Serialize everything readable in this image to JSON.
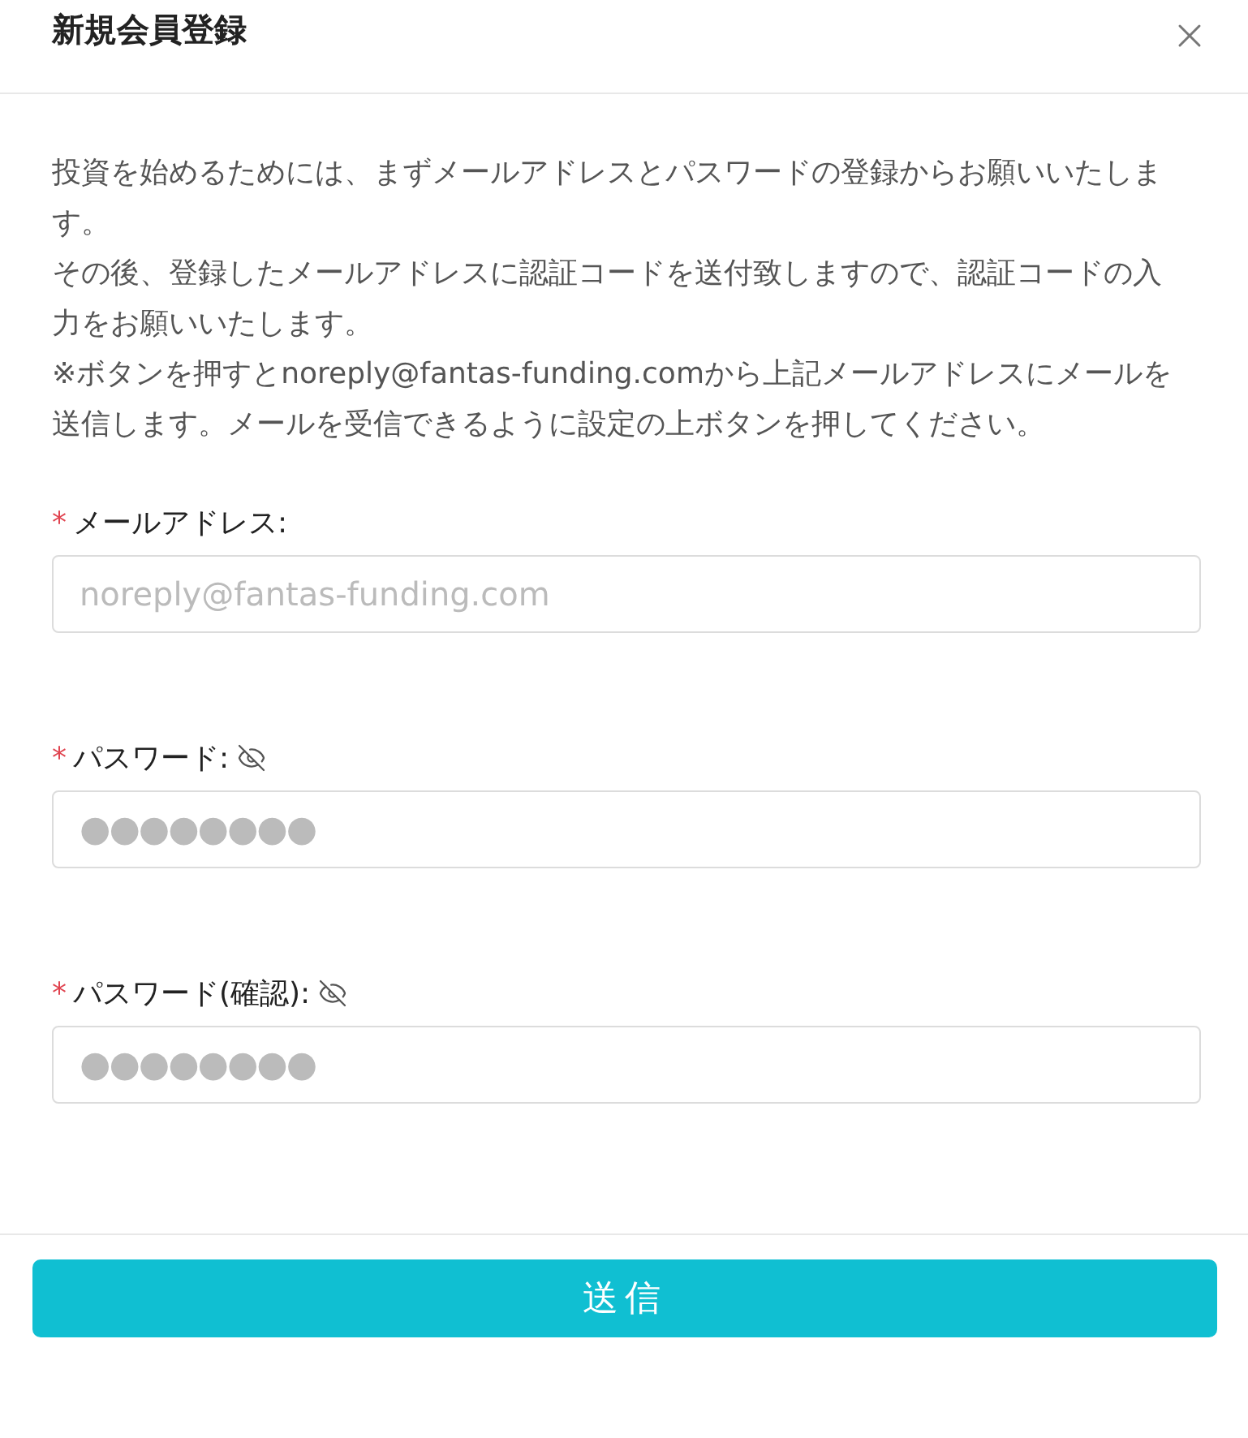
{
  "dialog": {
    "title": "新規会員登録"
  },
  "intro": [
    "投資を始めるためには、まずメールアドレスとパスワードの登録からお願いいたします。",
    "その後、登録したメールアドレスに認証コードを送付致しますので、認証コードの入力をお願いいたします。",
    "※ボタンを押すとnoreply@fantas-funding.comから上記メールアドレスにメールを送信します。メールを受信できるように設定の上ボタンを押してください。"
  ],
  "fields": [
    {
      "kind": "email",
      "required_mark": "*",
      "label": "メールアドレス:",
      "placeholder": "noreply@fantas-funding.com",
      "visibility_toggle": false
    },
    {
      "kind": "password",
      "required_mark": "*",
      "label": "パスワード:",
      "placeholder": "●●●●●●●●",
      "visibility_toggle": true
    },
    {
      "kind": "password",
      "required_mark": "*",
      "label": "パスワード(確認):",
      "placeholder": "●●●●●●●●",
      "visibility_toggle": true
    }
  ],
  "submit": {
    "label": "送信"
  }
}
